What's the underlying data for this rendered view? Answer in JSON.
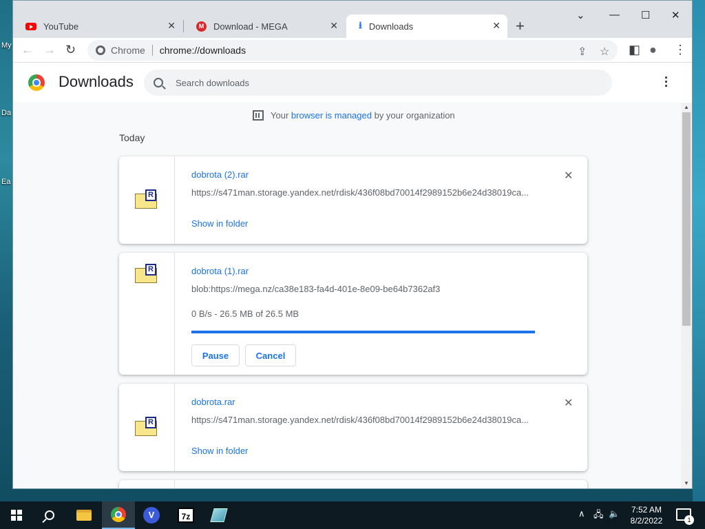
{
  "desktop": {
    "labels": [
      "My",
      "Da",
      "Ea"
    ]
  },
  "browser": {
    "tabs": [
      {
        "label": "YouTube",
        "icon": "youtube-icon"
      },
      {
        "label": "Download - MEGA",
        "icon": "mega-icon"
      },
      {
        "label": "Downloads",
        "icon": "download-icon",
        "active": true
      }
    ],
    "omnibox": {
      "label": "Chrome",
      "url": "chrome://downloads"
    }
  },
  "downloads_page": {
    "title": "Downloads",
    "search_placeholder": "Search downloads",
    "managed": {
      "prefix": "Your ",
      "link": "browser is managed",
      "suffix": " by your organization"
    },
    "section_label": "Today",
    "items": [
      {
        "filename": "dobrota (2).rar",
        "url": "https://s471man.storage.yandex.net/rdisk/436f08bd70014f2989152b6e24d38019ca...",
        "action": "Show in folder"
      },
      {
        "filename": "dobrota (1).rar",
        "url": "blob:https://mega.nz/ca38e183-fa4d-401e-8e09-be64b7362af3",
        "status": "0 B/s - 26.5 MB of 26.5 MB",
        "progress_percent": 100,
        "pause_label": "Pause",
        "cancel_label": "Cancel"
      },
      {
        "filename": "dobrota.rar",
        "url": "https://s471man.storage.yandex.net/rdisk/436f08bd70014f2989152b6e24d38019ca...",
        "action": "Show in folder"
      }
    ]
  },
  "taskbar": {
    "time": "7:52 AM",
    "date": "8/2/2022",
    "notification_count": "1",
    "apps": [
      "start-button",
      "search-button",
      "file-explorer",
      "chrome",
      "vpn-app",
      "7zip",
      "book-app"
    ]
  },
  "colors": {
    "accent": "#1a73e8",
    "tab_strip": "#dee1e6",
    "taskbar": "#0d1a22"
  }
}
